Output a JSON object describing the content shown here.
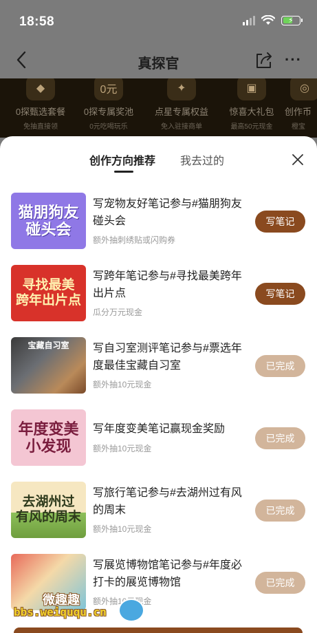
{
  "status_bar": {
    "time": "18:58"
  },
  "nav": {
    "title": "真探官"
  },
  "perks": [
    {
      "title": "0探甄选套餐",
      "sub": "免抽直接领",
      "icon": "diamond-icon"
    },
    {
      "title": "0探专属奖池",
      "sub": "0元吃喝玩乐",
      "icon": "coupon-icon"
    },
    {
      "title": "点星专属权益",
      "sub": "免入驻接商单",
      "icon": "star-icon"
    },
    {
      "title": "惊喜大礼包",
      "sub": "最高50元现金",
      "icon": "gift-icon"
    },
    {
      "title": "创作币",
      "sub": "橙宝",
      "icon": "coin-icon"
    }
  ],
  "tabs": {
    "active": "创作方向推荐",
    "inactive": "我去过的"
  },
  "tasks": [
    {
      "thumb_text": "猫朋狗友\n碰头会",
      "title": "写宠物友好笔记参与#猫朋狗友碰头会",
      "sub": "额外抽刺绣贴或闪购券",
      "button": "写笔记",
      "state": "write"
    },
    {
      "thumb_text": "寻找最美\n跨年出片点",
      "title": "写跨年笔记参与#寻找最美跨年出片点",
      "sub": "瓜分万元现金",
      "button": "写笔记",
      "state": "write"
    },
    {
      "thumb_text": "宝藏自习室",
      "title": "写自习室测评笔记参与#票选年度最佳宝藏自习室",
      "sub": "额外抽10元现金",
      "button": "已完成",
      "state": "done"
    },
    {
      "thumb_text": "年度变美\n小发现",
      "title": "写年度变美笔记赢现金奖励",
      "sub": "额外抽10元现金",
      "button": "已完成",
      "state": "done"
    },
    {
      "thumb_text": "去湖州过\n有风的周末",
      "title": "写旅行笔记参与#去湖州过有风的周末",
      "sub": "额外抽10元现金",
      "button": "已完成",
      "state": "done"
    },
    {
      "thumb_text": "",
      "title": "写展览博物馆笔记参与#年度必打卡的展览博物馆",
      "sub": "额外抽10元现金",
      "button": "已完成",
      "state": "done"
    }
  ],
  "watermark": {
    "name": "微趣趣",
    "url": "bbs.weiququ.cn"
  },
  "colors": {
    "write_button": "#8a4a1f",
    "done_button": "#d2b59b",
    "perk_band": "#1b1409"
  }
}
